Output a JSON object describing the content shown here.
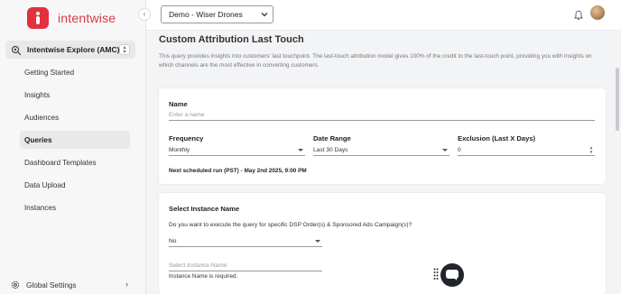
{
  "brand": {
    "name": "intentwise",
    "accent": "#e2313c"
  },
  "sidebar": {
    "selector_label": "Intentwise Explore (AMC)",
    "items": [
      {
        "label": "Getting Started"
      },
      {
        "label": "Insights"
      },
      {
        "label": "Audiences"
      },
      {
        "label": "Queries",
        "active": true
      },
      {
        "label": "Dashboard Templates"
      },
      {
        "label": "Data Upload"
      },
      {
        "label": "Instances"
      }
    ],
    "footer_label": "Global Settings"
  },
  "header": {
    "account_selected": "Demo - Wiser Drones"
  },
  "page": {
    "title": "Custom Attribution Last Touch",
    "description": "This query provides insights into customers' last touchpoint. The last-touch attribution model gives 100% of the credit to the last-touch point, providing you with insights on which channels are the most effective in converting customers."
  },
  "form": {
    "name_label": "Name",
    "name_placeholder": "Enter a name",
    "frequency_label": "Frequency",
    "frequency_value": "Monthly",
    "date_range_label": "Date Range",
    "date_range_value": "Last 30 Days",
    "exclusion_label": "Exclusion (Last X Days)",
    "exclusion_value": "0",
    "next_run": "Next scheduled run (PST) - May 2nd 2025, 9:00 PM"
  },
  "instance": {
    "title": "Select Instance Name",
    "question": "Do you want to execute the query for specific DSP Order(s) & Sponsored Ads Campaign(s)?",
    "answer_value": "No",
    "instance_placeholder": "Select Instance Name",
    "error": "Instance Name is required."
  }
}
